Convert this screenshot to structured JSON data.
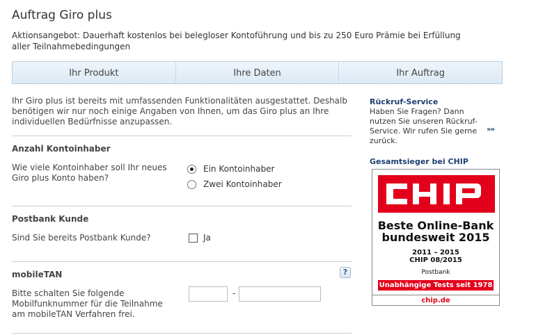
{
  "page": {
    "title": "Auftrag Giro plus",
    "promo": "Aktionsangebot: Dauerhaft kostenlos bei belegloser Kontoführung und bis zu 250 Euro Prämie bei Erfüllung aller Teilnahmebedingungen"
  },
  "steps": [
    "Ihr Produkt",
    "Ihre Daten",
    "Ihr Auftrag"
  ],
  "intro": "Ihr Giro plus ist bereits mit umfassenden Funktionalitäten ausgestattet. Deshalb benötigen wir nur noch einige Angaben von Ihnen, um das Giro plus an Ihre individuellen Bedürfnisse anzupassen.",
  "sections": {
    "holders": {
      "title": "Anzahl Kontoinhaber",
      "question": "Wie viele Kontoinhaber soll Ihr neues Giro plus Konto haben?",
      "options": [
        "Ein Kontoinhaber",
        "Zwei Kontoinhaber"
      ],
      "selected": "Ein Kontoinhaber"
    },
    "customer": {
      "title": "Postbank Kunde",
      "question": "Sind Sie bereits Postbank Kunde?",
      "checkbox_label": "Ja"
    },
    "mobiletan": {
      "title": "mobileTAN",
      "help_label": "?",
      "question": "Bitte schalten Sie folgende Mobilfunknummer für die Teilnahme am mobileTAN Verfahren frei.",
      "separator": "-",
      "prefix_value": "",
      "number_value": ""
    }
  },
  "sidebar": {
    "callback_title": "Rückruf-Service",
    "callback_text": "Haben Sie Fragen? Dann nutzen Sie unseren Rückruf-Service. Wir rufen Sie gerne zurück.",
    "callback_link": "»»",
    "award_title": "Gesamtsieger bei CHIP",
    "badge": {
      "logo_text": "CHIP",
      "headline_1": "Beste Online-Bank",
      "headline_2": "bundesweit 2015",
      "years": "2011 – 2015",
      "issue": "CHIP 08/2015",
      "bank": "Postbank",
      "banner": "Unabhängige Tests seit 1978",
      "url": "chip.de",
      "brand_color": "#e3001b"
    }
  }
}
